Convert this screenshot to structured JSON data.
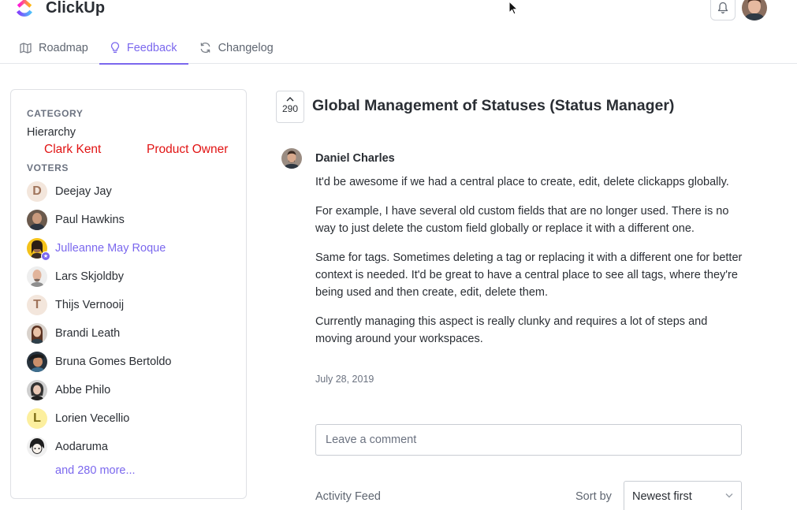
{
  "app": {
    "name": "ClickUp"
  },
  "tabs": [
    {
      "label": "Roadmap",
      "icon": "map-icon"
    },
    {
      "label": "Feedback",
      "icon": "lightbulb-icon",
      "active": true
    },
    {
      "label": "Changelog",
      "icon": "refresh-icon"
    }
  ],
  "sidebar": {
    "category_title": "CATEGORY",
    "category_value": "Hierarchy",
    "overlay_left": "Clark Kent",
    "overlay_right": "Product Owner",
    "voters_title": "VOTERS",
    "voters": [
      {
        "name": "Deejay Jay",
        "initial": "D"
      },
      {
        "name": "Paul Hawkins"
      },
      {
        "name": "Julleanne May Roque",
        "highlight": true
      },
      {
        "name": "Lars Skjoldby"
      },
      {
        "name": "Thijs Vernooij",
        "initial": "T"
      },
      {
        "name": "Brandi Leath"
      },
      {
        "name": "Bruna Gomes Bertoldo"
      },
      {
        "name": "Abbe Philo"
      },
      {
        "name": "Lorien Vecellio",
        "initial": "L"
      },
      {
        "name": "Aodaruma"
      }
    ],
    "more_label": "and 280 more..."
  },
  "post": {
    "votes": "290",
    "title": "Global Management of Statuses (Status Manager)",
    "author": "Daniel Charles",
    "paragraphs": [
      "It'd be awesome if we had a central place to create, edit, delete clickapps globally.",
      "For example, I have several old custom fields that are no longer used. There is no way to just delete the custom field globally or replace it with a different one.",
      "Same for tags. Sometimes deleting a tag or replacing it with a different one for better context is needed. It'd be great to have a central place to see all tags, where they're being used and then create, edit, delete them.",
      "Currently managing this aspect is really clunky and requires a lot of steps and moving around your workspaces."
    ],
    "date": "July 28, 2019"
  },
  "comment": {
    "placeholder": "Leave a comment"
  },
  "feed": {
    "label": "Activity Feed",
    "sort_label": "Sort by",
    "sort_value": "Newest first"
  },
  "colors": {
    "accent": "#7b68ee",
    "overlay_red": "#e11313"
  }
}
